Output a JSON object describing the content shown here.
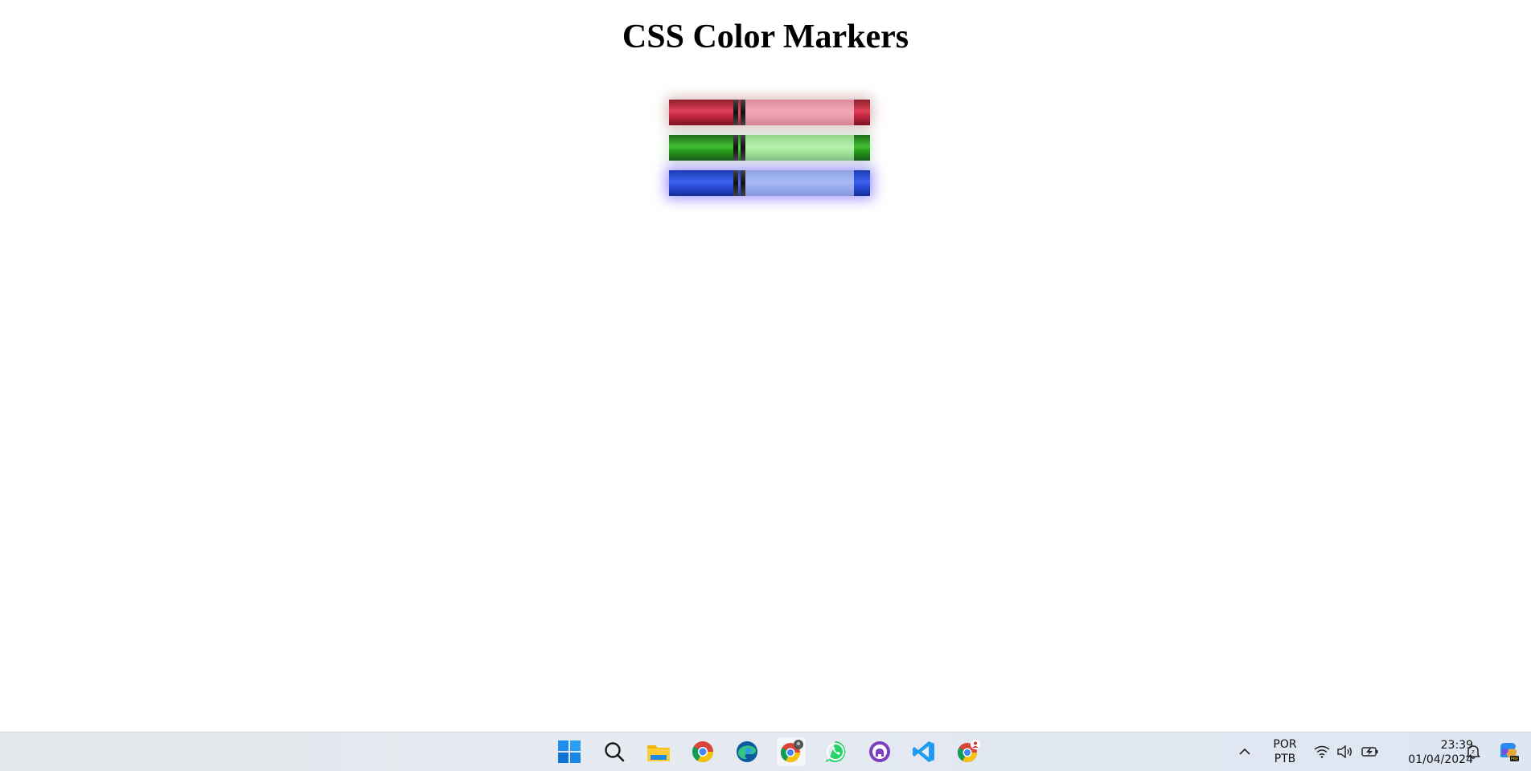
{
  "page": {
    "title": "CSS Color Markers"
  },
  "markers": [
    {
      "color": "red",
      "accent": "#e0405a"
    },
    {
      "color": "green",
      "accent": "#43c033"
    },
    {
      "color": "blue",
      "accent": "#3e62f0"
    }
  ],
  "taskbar": {
    "icons": [
      "windows-start-icon",
      "search-icon",
      "file-explorer-icon",
      "chrome-icon",
      "edge-icon",
      "chrome-profile-icon",
      "whatsapp-icon",
      "github-desktop-icon",
      "vscode-icon",
      "chrome-user-icon"
    ],
    "language_top": "POR",
    "language_bottom": "PTB",
    "time": "23:39",
    "date": "01/04/2024"
  }
}
